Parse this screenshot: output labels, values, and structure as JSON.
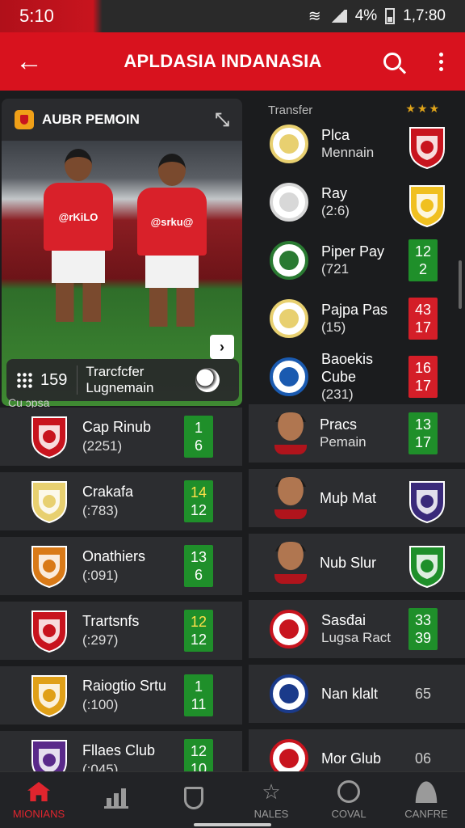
{
  "status_bar": {
    "time": "5:10",
    "battery": "4%",
    "clock": "1,7:80"
  },
  "app_bar": {
    "title": "APLDASIA INDANASIA",
    "back_icon": "arrow-left-icon",
    "search_icon": "search-icon",
    "menu_icon": "more-vert-icon"
  },
  "featured": {
    "title": "AUBR PEMOIN",
    "count": "159",
    "caption_line1": "Trarcfcfer",
    "caption_line2": "Lugnemain",
    "shirt_text_1": "@rKiLO",
    "shirt_text_2": "@srku@",
    "section_label": "Cu ɔpsa"
  },
  "left_list": [
    {
      "name": "Cap Rinub",
      "sub": "(2251)",
      "score_top": "1",
      "score_bottom": "6",
      "score_color": "green",
      "crest_color": "#c8141e"
    },
    {
      "name": "Crakafa",
      "sub": "(:783)",
      "score_top": "14",
      "score_bottom": "12",
      "score_color": "yellow",
      "crest_color": "#e8d070"
    },
    {
      "name": "Onathiers",
      "sub": "(:091)",
      "score_top": "13",
      "score_bottom": "6",
      "score_color": "green",
      "crest_color": "#d97a18"
    },
    {
      "name": "Trartsnfs",
      "sub": "(:297)",
      "score_top": "12",
      "score_bottom": "12",
      "score_color": "yellow",
      "crest_color": "#c8141e"
    },
    {
      "name": "Raiogtio Srtu",
      "sub": "(:100)",
      "score_top": "1",
      "score_bottom": "11",
      "score_color": "green",
      "crest_color": "#e0a018"
    },
    {
      "name": "Fllaes Club",
      "sub": "(:045)",
      "score_top": "12",
      "score_bottom": "10",
      "score_color": "green",
      "crest_color": "#5a2a8a"
    }
  ],
  "right_header": {
    "label": "Transfer",
    "stars": "★★★"
  },
  "right_list": [
    {
      "name": "Plca",
      "sub": "Mennain",
      "score_top": "",
      "score_bottom": "",
      "type": "badge",
      "crest_color": "#e8d070",
      "badge_color": "#c8141e"
    },
    {
      "name": "Ray",
      "sub": "(2:6)",
      "score_top": "",
      "score_bottom": "",
      "type": "badge",
      "crest_color": "#d8d8d8",
      "badge_color": "#f0c020"
    },
    {
      "name": "Piper Pay",
      "sub": "(721",
      "score_top": "12",
      "score_bottom": "2",
      "type": "green",
      "crest_color": "#2a7a32"
    },
    {
      "name": "Pajpa Pas",
      "sub": "(15)",
      "score_top": "43",
      "score_bottom": "17",
      "type": "red",
      "crest_color": "#e8d070"
    },
    {
      "name": "Baoekis Cube",
      "sub": "(231)",
      "score_top": "16",
      "score_bottom": "17",
      "type": "red",
      "crest_color": "#1a5ab0"
    },
    {
      "name": "Pracs",
      "sub": "Pemain",
      "score_top": "13",
      "score_bottom": "17",
      "type": "green",
      "face": true
    },
    {
      "name": "Muþ Mat",
      "sub": "",
      "score_top": "",
      "score_bottom": "",
      "type": "badge",
      "face": true,
      "badge_color": "#3a2a7a"
    },
    {
      "name": "Nub Slur",
      "sub": "",
      "score_top": "",
      "score_bottom": "",
      "type": "badge",
      "face": true,
      "badge_color": "#1f8f2a"
    },
    {
      "name": "Sasđai",
      "sub": "Lugsa Ract",
      "score_top": "33",
      "score_bottom": "39",
      "type": "green",
      "crest_color": "#c8141e"
    },
    {
      "name": "Nan klalt",
      "sub": "",
      "score_top": "65",
      "score_bottom": "",
      "type": "plain",
      "crest_color": "#1a3a8a"
    },
    {
      "name": "Mor Glub",
      "sub": "",
      "score_top": "06",
      "score_bottom": "",
      "type": "plain",
      "crest_color": "#c8141e"
    }
  ],
  "tabs": [
    {
      "label": "MIONIANS",
      "icon": "home-icon",
      "active": true
    },
    {
      "label": "",
      "icon": "stats-icon",
      "active": false
    },
    {
      "label": "",
      "icon": "shield-icon",
      "active": false
    },
    {
      "label": "NALES",
      "icon": "star-icon",
      "active": false
    },
    {
      "label": "COVAL",
      "icon": "clock-icon",
      "active": false
    },
    {
      "label": "CANFRE",
      "icon": "profile-icon",
      "active": false
    }
  ]
}
